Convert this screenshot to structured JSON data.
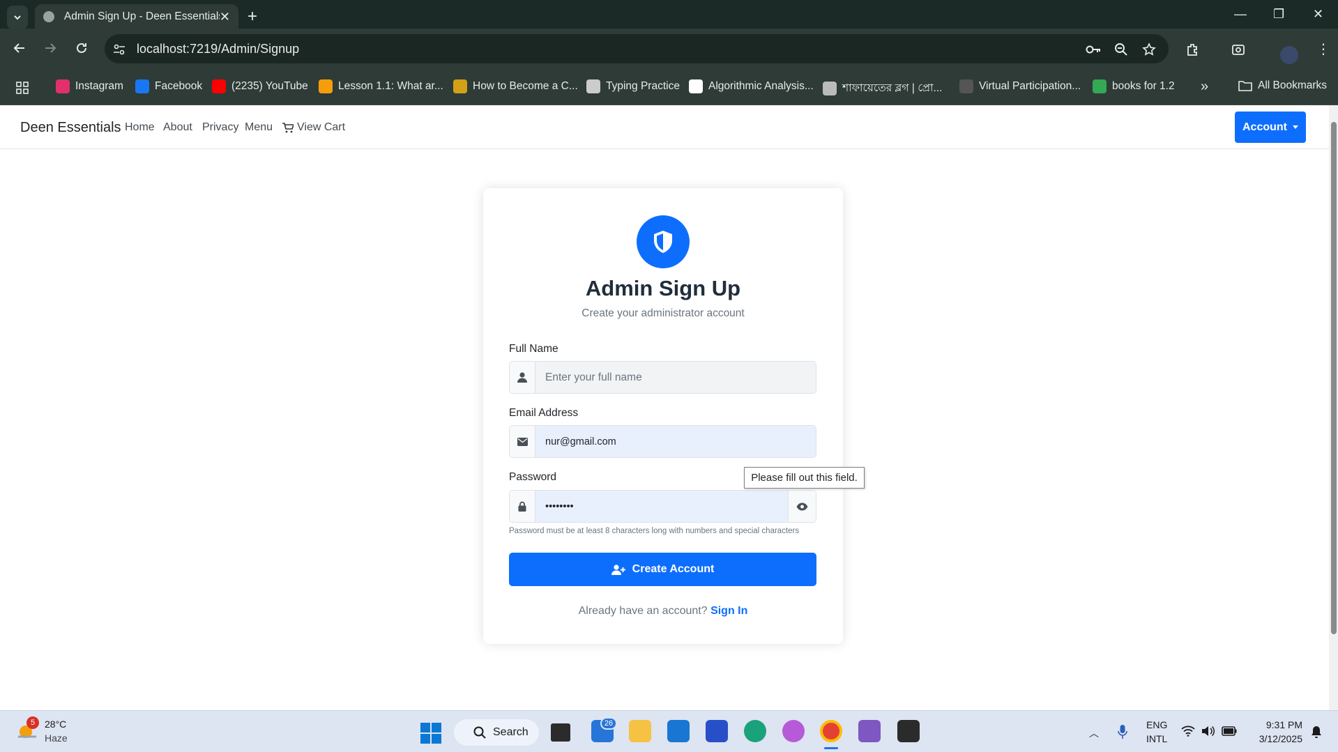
{
  "browser": {
    "tab_title": "Admin Sign Up - Deen Essentials",
    "url": "localhost:7219/Admin/Signup",
    "bookmarks": [
      {
        "label": "Instagram",
        "color": "#e1306c"
      },
      {
        "label": "Facebook",
        "color": "#1877f2"
      },
      {
        "label": "(2235) YouTube",
        "color": "#ff0000"
      },
      {
        "label": "Lesson 1.1: What ar...",
        "color": "#f59e0b"
      },
      {
        "label": "How to Become a C...",
        "color": "#d4a017"
      },
      {
        "label": "Typing Practice",
        "color": "#cccccc"
      },
      {
        "label": "Algorithmic Analysis...",
        "color": "#ffffff"
      },
      {
        "label": "শাফায়েতের ব্লগ | প্রো...",
        "color": "#bbbbbb"
      },
      {
        "label": "Virtual Participation...",
        "color": "#555555"
      },
      {
        "label": "books for 1.2",
        "color": "#34a853"
      }
    ],
    "all_bookmarks": "All Bookmarks"
  },
  "navbar": {
    "brand": "Deen Essentials",
    "links": [
      "Home",
      "About",
      "Privacy",
      "Menu"
    ],
    "cart": "View Cart",
    "account": "Account"
  },
  "form": {
    "title": "Admin Sign Up",
    "subtitle": "Create your administrator account",
    "full_name_label": "Full Name",
    "full_name_placeholder": "Enter your full name",
    "email_label": "Email Address",
    "email_value": "nur@gmail.com",
    "password_label": "Password",
    "password_value": "••••••••",
    "password_hint": "Password must be at least 8 characters long with numbers and special characters",
    "submit": "Create Account",
    "already_text": "Already have an account?",
    "sign_in": "Sign In",
    "tooltip": "Please fill out this field."
  },
  "taskbar": {
    "weather_temp": "28°C",
    "weather_desc": "Haze",
    "weather_badge": "5",
    "search": "Search",
    "badge_count": "26",
    "lang": "ENG",
    "lang2": "INTL",
    "time": "9:31 PM",
    "date": "3/12/2025"
  },
  "colors": {
    "primary": "#0d6efd",
    "chrome_bg": "#2e3b37"
  }
}
